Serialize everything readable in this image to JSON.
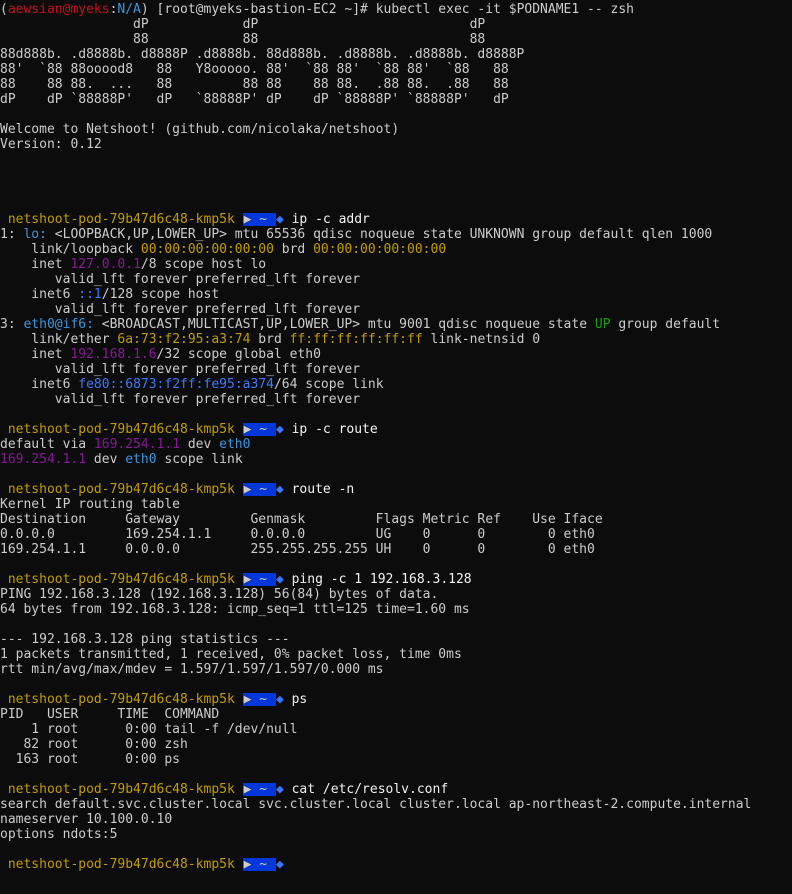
{
  "colors": {
    "background": "#0c0c0c",
    "text": "#cccccc",
    "bright": "#f2f2f2",
    "red": "#c50f1f",
    "yellow": "#c19c00",
    "magenta": "#881798",
    "blue": "#3b78ff",
    "cyan": "#3a96dd",
    "green": "#13a10e",
    "prompt_bg": "#0037da"
  },
  "lines": [
    {
      "segs": [
        [
          "(",
          ""
        ],
        [
          "aewsian@myeks",
          "red"
        ],
        [
          ":",
          ""
        ],
        [
          "N/A",
          "cyan"
        ],
        [
          ") [root@myeks-bastion-EC2 ~]# kubectl exec -it $PODNAME1 -- zsh",
          ""
        ]
      ]
    },
    {
      "segs": [
        [
          "                 dP            dP                           dP",
          ""
        ]
      ]
    },
    {
      "segs": [
        [
          "                 88            88                           88",
          ""
        ]
      ]
    },
    {
      "segs": [
        [
          "88d888b. .d8888b. d8888P .d8888b. 88d888b. .d8888b. .d8888b. d8888P",
          ""
        ]
      ]
    },
    {
      "segs": [
        [
          "88'  `88 88ooood8   88   Y8ooooo. 88'  `88 88'  `88 88'  `88   88",
          ""
        ]
      ]
    },
    {
      "segs": [
        [
          "88    88 88.  ...   88         88 88    88 88.  .88 88.  .88   88",
          ""
        ]
      ]
    },
    {
      "segs": [
        [
          "dP    dP `88888P'   dP   `88888P' dP    dP `88888P' `88888P'   dP",
          ""
        ]
      ]
    },
    {
      "segs": []
    },
    {
      "segs": [
        [
          "Welcome to Netshoot! (github.com/nicolaka/netshoot)",
          ""
        ]
      ]
    },
    {
      "segs": [
        [
          "Version: 0.12",
          ""
        ]
      ]
    },
    {
      "segs": []
    },
    {
      "segs": []
    },
    {
      "segs": []
    },
    {
      "segs": []
    },
    {
      "prompt": true,
      "cmd": "ip -c addr"
    },
    {
      "segs": [
        [
          "1: ",
          ""
        ],
        [
          "lo:",
          "cyan"
        ],
        [
          " <LOOPBACK,UP,LOWER_UP> mtu 65536 qdisc noqueue state UNKNOWN group default qlen 1000",
          ""
        ]
      ]
    },
    {
      "segs": [
        [
          "    link/loopback ",
          ""
        ],
        [
          "00:00:00:00:00:00",
          "yellow"
        ],
        [
          " brd ",
          ""
        ],
        [
          "00:00:00:00:00:00",
          "yellow"
        ]
      ]
    },
    {
      "segs": [
        [
          "    inet ",
          ""
        ],
        [
          "127.0.0.1",
          "magenta"
        ],
        [
          "/8 scope host lo",
          ""
        ]
      ]
    },
    {
      "segs": [
        [
          "       valid_lft forever preferred_lft forever",
          ""
        ]
      ]
    },
    {
      "segs": [
        [
          "    inet6 ",
          ""
        ],
        [
          "::1",
          "blue"
        ],
        [
          "/128 scope host",
          ""
        ]
      ]
    },
    {
      "segs": [
        [
          "       valid_lft forever preferred_lft forever",
          ""
        ]
      ]
    },
    {
      "segs": [
        [
          "3: ",
          ""
        ],
        [
          "eth0@if6:",
          "cyan"
        ],
        [
          " <BROADCAST,MULTICAST,UP,LOWER_UP> mtu 9001 qdisc noqueue state ",
          ""
        ],
        [
          "UP",
          "green"
        ],
        [
          " group default",
          ""
        ]
      ]
    },
    {
      "segs": [
        [
          "    link/ether ",
          ""
        ],
        [
          "6a:73:f2:95:a3:74",
          "yellow"
        ],
        [
          " brd ",
          ""
        ],
        [
          "ff:ff:ff:ff:ff:ff",
          "yellow"
        ],
        [
          " link-netnsid 0",
          ""
        ]
      ]
    },
    {
      "segs": [
        [
          "    inet ",
          ""
        ],
        [
          "192.168.1.6",
          "magenta"
        ],
        [
          "/32 scope global eth0",
          ""
        ]
      ]
    },
    {
      "segs": [
        [
          "       valid_lft forever preferred_lft forever",
          ""
        ]
      ]
    },
    {
      "segs": [
        [
          "    inet6 ",
          ""
        ],
        [
          "fe80::6873:f2ff:fe95:a374",
          "blue"
        ],
        [
          "/64 scope link",
          ""
        ]
      ]
    },
    {
      "segs": [
        [
          "       valid_lft forever preferred_lft forever",
          ""
        ]
      ]
    },
    {
      "segs": []
    },
    {
      "prompt": true,
      "cmd": "ip -c route"
    },
    {
      "segs": [
        [
          "default via ",
          ""
        ],
        [
          "169.254.1.1",
          "magenta"
        ],
        [
          " dev ",
          ""
        ],
        [
          "eth0",
          "cyan"
        ]
      ]
    },
    {
      "segs": [
        [
          "169.254.1.1",
          "magenta"
        ],
        [
          " dev ",
          ""
        ],
        [
          "eth0",
          "cyan"
        ],
        [
          " scope link",
          ""
        ]
      ]
    },
    {
      "segs": []
    },
    {
      "prompt": true,
      "cmd": "route -n"
    },
    {
      "segs": [
        [
          "Kernel IP routing table",
          ""
        ]
      ]
    },
    {
      "segs": [
        [
          "Destination     Gateway         Genmask         Flags Metric Ref    Use Iface",
          ""
        ]
      ]
    },
    {
      "segs": [
        [
          "0.0.0.0         169.254.1.1     0.0.0.0         UG    0      0        0 eth0",
          ""
        ]
      ]
    },
    {
      "segs": [
        [
          "169.254.1.1     0.0.0.0         255.255.255.255 UH    0      0        0 eth0",
          ""
        ]
      ]
    },
    {
      "segs": []
    },
    {
      "prompt": true,
      "cmd": "ping -c 1 192.168.3.128"
    },
    {
      "segs": [
        [
          "PING 192.168.3.128 (192.168.3.128) 56(84) bytes of data.",
          ""
        ]
      ]
    },
    {
      "segs": [
        [
          "64 bytes from 192.168.3.128: icmp_seq=1 ttl=125 time=1.60 ms",
          ""
        ]
      ]
    },
    {
      "segs": []
    },
    {
      "segs": [
        [
          "--- 192.168.3.128 ping statistics ---",
          ""
        ]
      ]
    },
    {
      "segs": [
        [
          "1 packets transmitted, 1 received, 0% packet loss, time 0ms",
          ""
        ]
      ]
    },
    {
      "segs": [
        [
          "rtt min/avg/max/mdev = 1.597/1.597/1.597/0.000 ms",
          ""
        ]
      ]
    },
    {
      "segs": []
    },
    {
      "prompt": true,
      "cmd": "ps"
    },
    {
      "segs": [
        [
          "PID   USER     TIME  COMMAND",
          ""
        ]
      ]
    },
    {
      "segs": [
        [
          "    1 root      0:00 tail -f /dev/null",
          ""
        ]
      ]
    },
    {
      "segs": [
        [
          "   82 root      0:00 zsh",
          ""
        ]
      ]
    },
    {
      "segs": [
        [
          "  163 root      0:00 ps",
          ""
        ]
      ]
    },
    {
      "segs": []
    },
    {
      "prompt": true,
      "cmd": "cat /etc/resolv.conf"
    },
    {
      "segs": [
        [
          "search default.svc.cluster.local svc.cluster.local cluster.local ap-northeast-2.compute.internal",
          ""
        ]
      ]
    },
    {
      "segs": [
        [
          "nameserver 10.100.0.10",
          ""
        ]
      ]
    },
    {
      "segs": [
        [
          "options ndots:5",
          ""
        ]
      ]
    },
    {
      "segs": []
    },
    {
      "prompt": true,
      "cmd": ""
    }
  ],
  "prompt": {
    "host": " netshoot-pod-79b47d6c48-kmp5k ",
    "segment": "▶ ~ ▶",
    "arrow": "⭐"
  }
}
